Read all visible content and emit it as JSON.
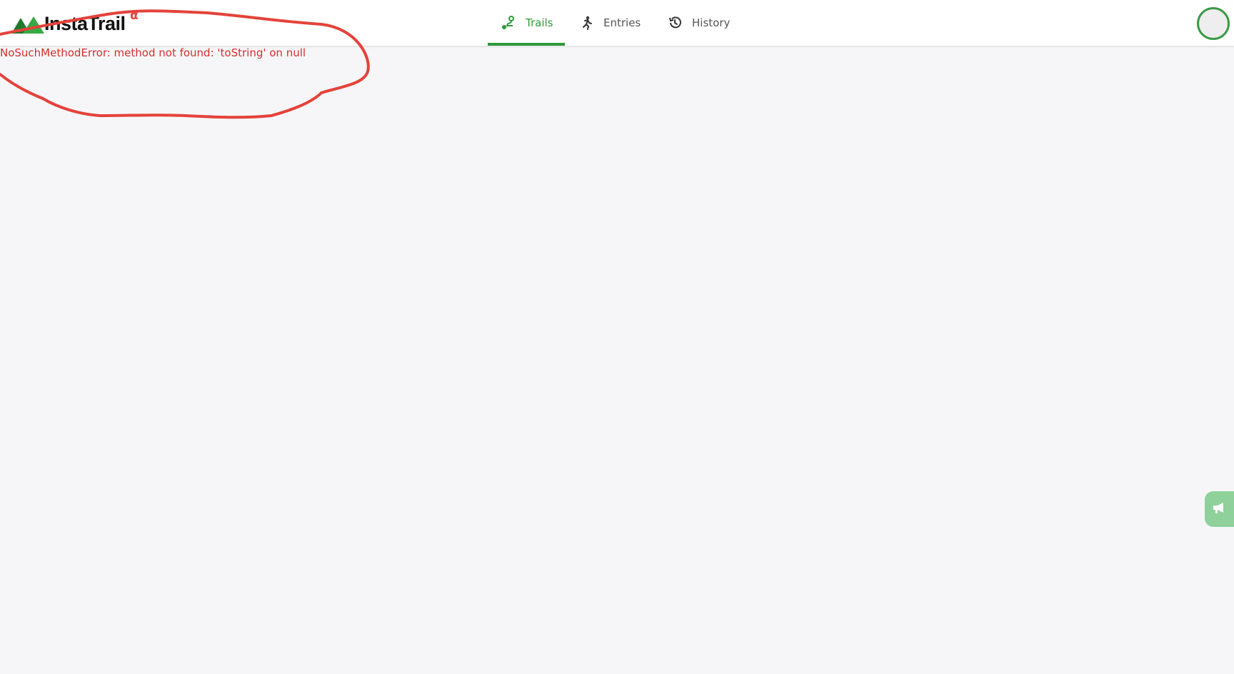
{
  "app": {
    "logo_text": "InstaTrail",
    "logo_superscript": "α"
  },
  "nav": {
    "items": [
      {
        "label": "Trails",
        "icon": "route-icon",
        "active": true
      },
      {
        "label": "Entries",
        "icon": "running-person-icon",
        "active": false
      },
      {
        "label": "History",
        "icon": "history-icon",
        "active": false
      }
    ]
  },
  "error": {
    "message": "NoSuchMethodError: method not found: 'toString' on null"
  },
  "colors": {
    "accent": "#2f9a3a",
    "error": "#d32f2f",
    "annotation": "#e4423a",
    "background": "#f6f6f8",
    "feedback_tab": "#8fd19a"
  }
}
